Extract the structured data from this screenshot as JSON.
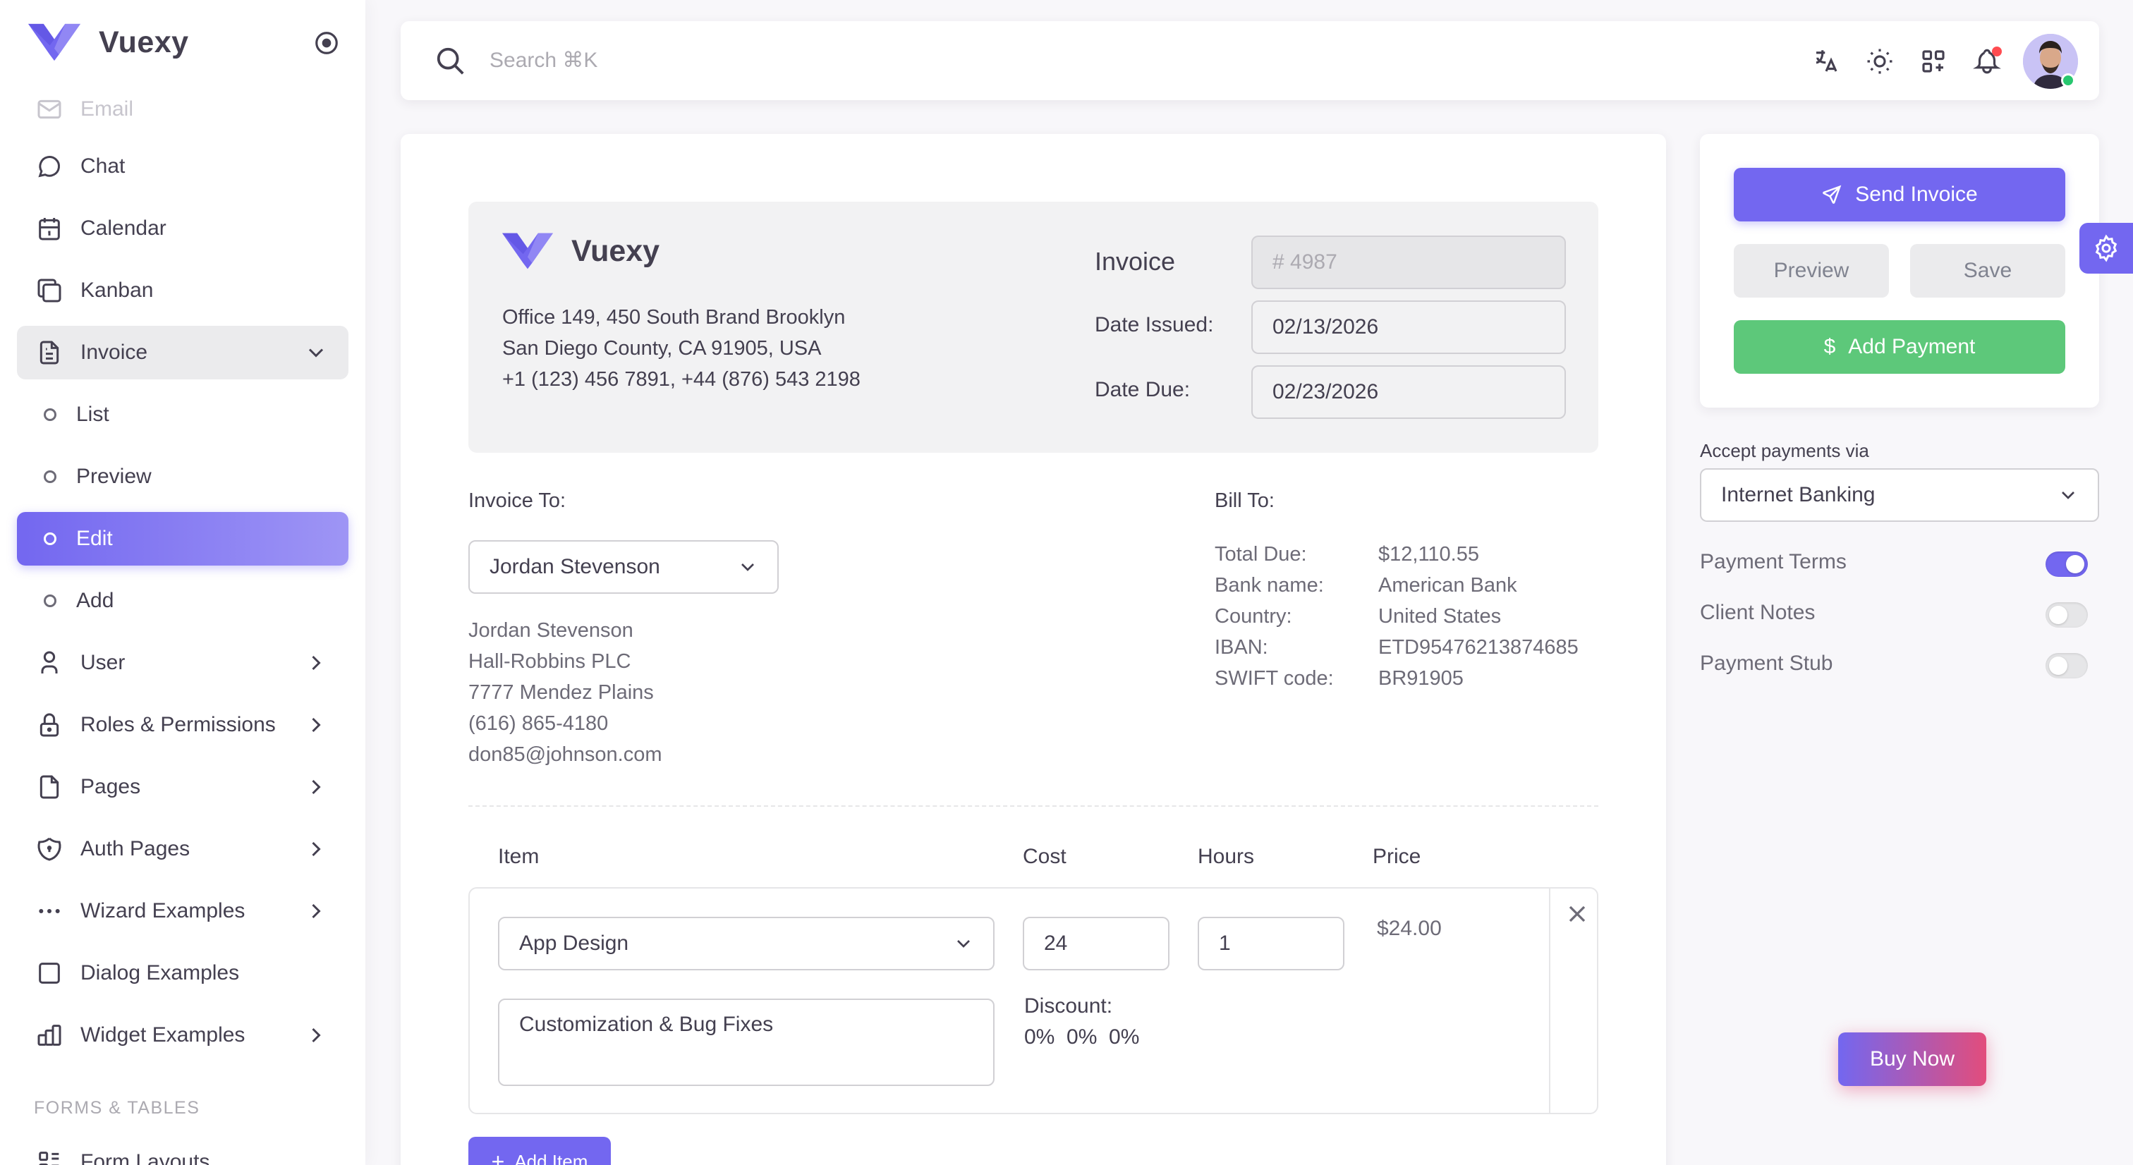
{
  "brand": {
    "name": "Vuexy"
  },
  "colors": {
    "primary": "#7367f0",
    "success": "#5dc87a",
    "danger": "#ff4c51",
    "online": "#28c76f"
  },
  "sidebar": {
    "items": [
      {
        "label": "Email",
        "icon": "mail-icon"
      },
      {
        "label": "Chat",
        "icon": "chat-icon"
      },
      {
        "label": "Calendar",
        "icon": "calendar-icon"
      },
      {
        "label": "Kanban",
        "icon": "kanban-icon"
      },
      {
        "label": "Invoice",
        "icon": "invoice-icon",
        "expanded": true
      },
      {
        "label": "List"
      },
      {
        "label": "Preview"
      },
      {
        "label": "Edit",
        "active": true
      },
      {
        "label": "Add"
      },
      {
        "label": "User",
        "icon": "user-icon"
      },
      {
        "label": "Roles & Permissions",
        "icon": "lock-icon"
      },
      {
        "label": "Pages",
        "icon": "file-icon"
      },
      {
        "label": "Auth Pages",
        "icon": "shield-icon"
      },
      {
        "label": "Wizard Examples",
        "icon": "dots-icon"
      },
      {
        "label": "Dialog Examples",
        "icon": "square-icon"
      },
      {
        "label": "Widget Examples",
        "icon": "chart-bar-icon"
      }
    ],
    "section_title": "FORMS & TABLES",
    "partial_item": "Form Layouts"
  },
  "topbar": {
    "search_placeholder": "Search ⌘K"
  },
  "invoice": {
    "company_address": [
      "Office 149, 450 South Brand Brooklyn",
      "San Diego County, CA 91905, USA",
      "+1 (123) 456 7891, +44 (876) 543 2198"
    ],
    "invoice_label": "Invoice",
    "invoice_number": "# 4987",
    "date_issued_label": "Date Issued:",
    "date_issued": "02/13/2026",
    "date_due_label": "Date Due:",
    "date_due": "02/23/2026",
    "invoice_to_label": "Invoice To:",
    "client_selected": "Jordan Stevenson",
    "client_details": [
      "Jordan Stevenson",
      "Hall-Robbins PLC",
      "7777 Mendez Plains",
      "(616) 865-4180",
      "don85@johnson.com"
    ],
    "bill_to_label": "Bill To:",
    "bill_to": [
      {
        "key": "Total Due:",
        "value": "$12,110.55"
      },
      {
        "key": "Bank name:",
        "value": "American Bank"
      },
      {
        "key": "Country:",
        "value": "United States"
      },
      {
        "key": "IBAN:",
        "value": "ETD95476213874685"
      },
      {
        "key": "SWIFT code:",
        "value": "BR91905"
      }
    ],
    "columns": [
      "Item",
      "Cost",
      "Hours",
      "Price"
    ],
    "line_item": {
      "item": "App Design",
      "description": "Customization & Bug Fixes",
      "cost": "24",
      "hours": "1",
      "price": "$24.00",
      "discount_label": "Discount:",
      "discounts": "0%  0%  0%"
    },
    "add_item_label": "Add Item"
  },
  "actions": {
    "send_label": "Send Invoice",
    "preview_label": "Preview",
    "save_label": "Save",
    "add_payment_label": "Add Payment",
    "accept_label": "Accept payments via",
    "payment_method": "Internet Banking",
    "toggles": [
      {
        "label": "Payment Terms",
        "on": true
      },
      {
        "label": "Client Notes",
        "on": false
      },
      {
        "label": "Payment Stub",
        "on": false
      }
    ]
  },
  "buy_now_label": "Buy Now"
}
